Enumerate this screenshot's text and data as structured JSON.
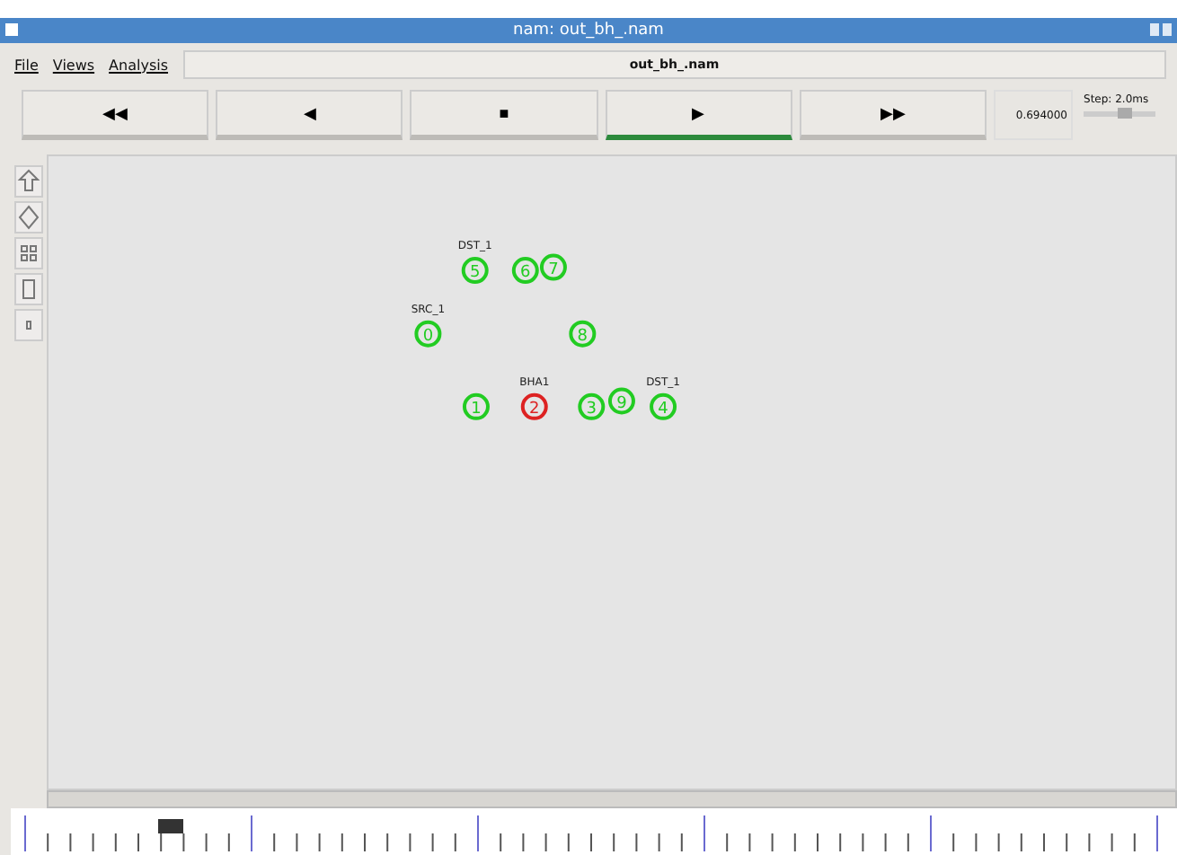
{
  "window": {
    "title": "nam: out_bh_.nam"
  },
  "menu": [
    {
      "label": "File"
    },
    {
      "label": "Views"
    },
    {
      "label": "Analysis"
    }
  ],
  "file_name": "out_bh_.nam",
  "controls": [
    {
      "symbol": "◀◀",
      "selected": false
    },
    {
      "symbol": "◀",
      "selected": false
    },
    {
      "symbol": "■",
      "selected": false
    },
    {
      "symbol": "▶",
      "selected": true
    },
    {
      "symbol": "▶▶",
      "selected": false
    }
  ],
  "time": "0.694000",
  "step": {
    "label": "Step: 2.0ms",
    "level": 0.6
  },
  "nodes": [
    {
      "id": "5",
      "label": "DST_1",
      "color": "#22cc22"
    },
    {
      "id": "6",
      "color": "#22cc22"
    },
    {
      "id": "7",
      "color": "#22cc22"
    },
    {
      "id": "0",
      "label": "SRC_1",
      "color": "#22cc22"
    },
    {
      "id": "8",
      "color": "#22cc22"
    },
    {
      "id": "1",
      "color": "#22cc22"
    },
    {
      "id": "2",
      "label": "BHA1",
      "color": "#dd2222"
    },
    {
      "id": "3",
      "color": "#22cc22"
    },
    {
      "id": "9",
      "color": "#22cc22"
    },
    {
      "id": "4",
      "label": "DST_1",
      "color": "#22cc22"
    }
  ],
  "timeline": {
    "level": 0.13
  }
}
